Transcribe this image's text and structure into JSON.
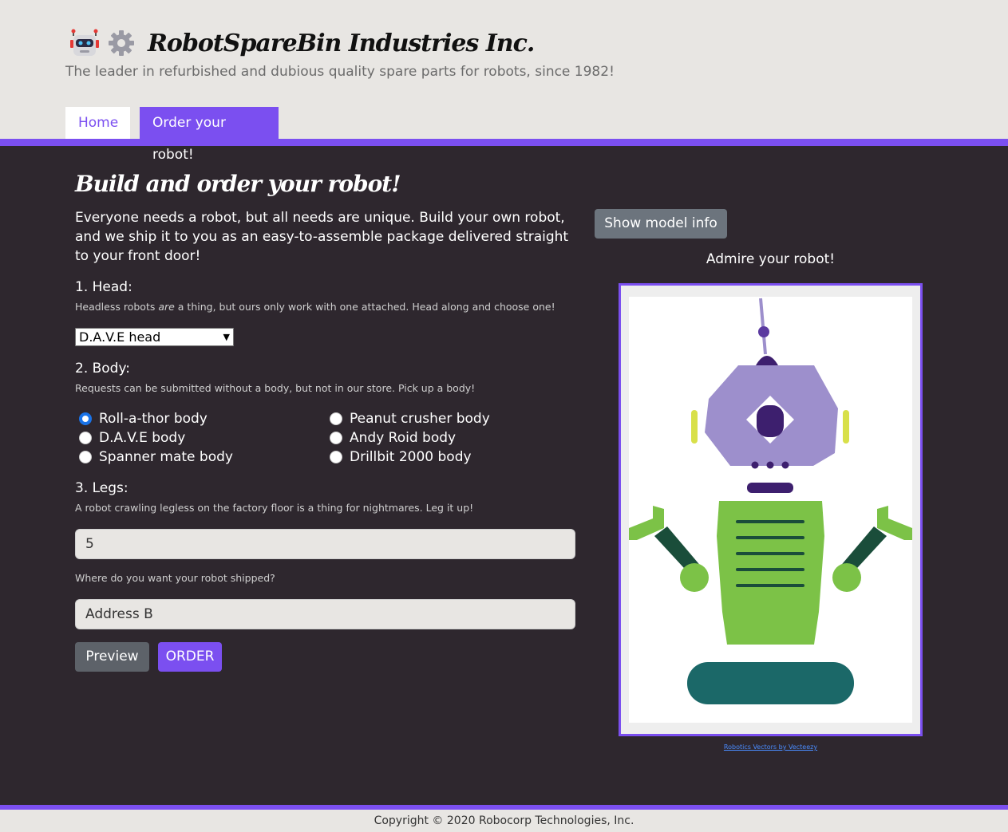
{
  "header": {
    "title": "RobotSpareBin Industries Inc.",
    "tagline": "The leader in refurbished and dubious quality spare parts for robots, since 1982!",
    "tabs": [
      {
        "label": "Home"
      },
      {
        "label": "Order your robot!"
      }
    ]
  },
  "form": {
    "title": "Build and order your robot!",
    "intro": "Everyone needs a robot, but all needs are unique. Build your own robot, and we ship it to you as an easy-to-assemble package delivered straight to your front door!",
    "head": {
      "label": "1. Head:",
      "hint_pre": "Headless robots ",
      "hint_em": "are",
      "hint_post": " a thing, but ours only work with one attached. Head along and choose one!",
      "selected": "D.A.V.E head"
    },
    "body": {
      "label": "2. Body:",
      "hint": "Requests can be submitted without a body, but not in our store. Pick up a body!",
      "options": [
        {
          "label": "Roll-a-thor body",
          "checked": true
        },
        {
          "label": "Peanut crusher body",
          "checked": false
        },
        {
          "label": "D.A.V.E body",
          "checked": false
        },
        {
          "label": "Andy Roid body",
          "checked": false
        },
        {
          "label": "Spanner mate body",
          "checked": false
        },
        {
          "label": "Drillbit 2000 body",
          "checked": false
        }
      ]
    },
    "legs": {
      "label": "3. Legs:",
      "hint": "A robot crawling legless on the factory floor is a thing for nightmares. Leg it up!",
      "value": "5"
    },
    "address": {
      "hint": "Where do you want your robot shipped?",
      "value": "Address B"
    },
    "buttons": {
      "preview": "Preview",
      "order": "ORDER"
    }
  },
  "preview": {
    "show_model_info": "Show model info",
    "admire": "Admire your robot!",
    "credit": "Robotics Vectors by Vecteezy"
  },
  "footer": {
    "copyright": "Copyright © 2020 Robocorp Technologies, Inc."
  },
  "colors": {
    "accent": "#7b4ff0",
    "background": "#2e272e",
    "header_bg": "#e8e6e3"
  }
}
